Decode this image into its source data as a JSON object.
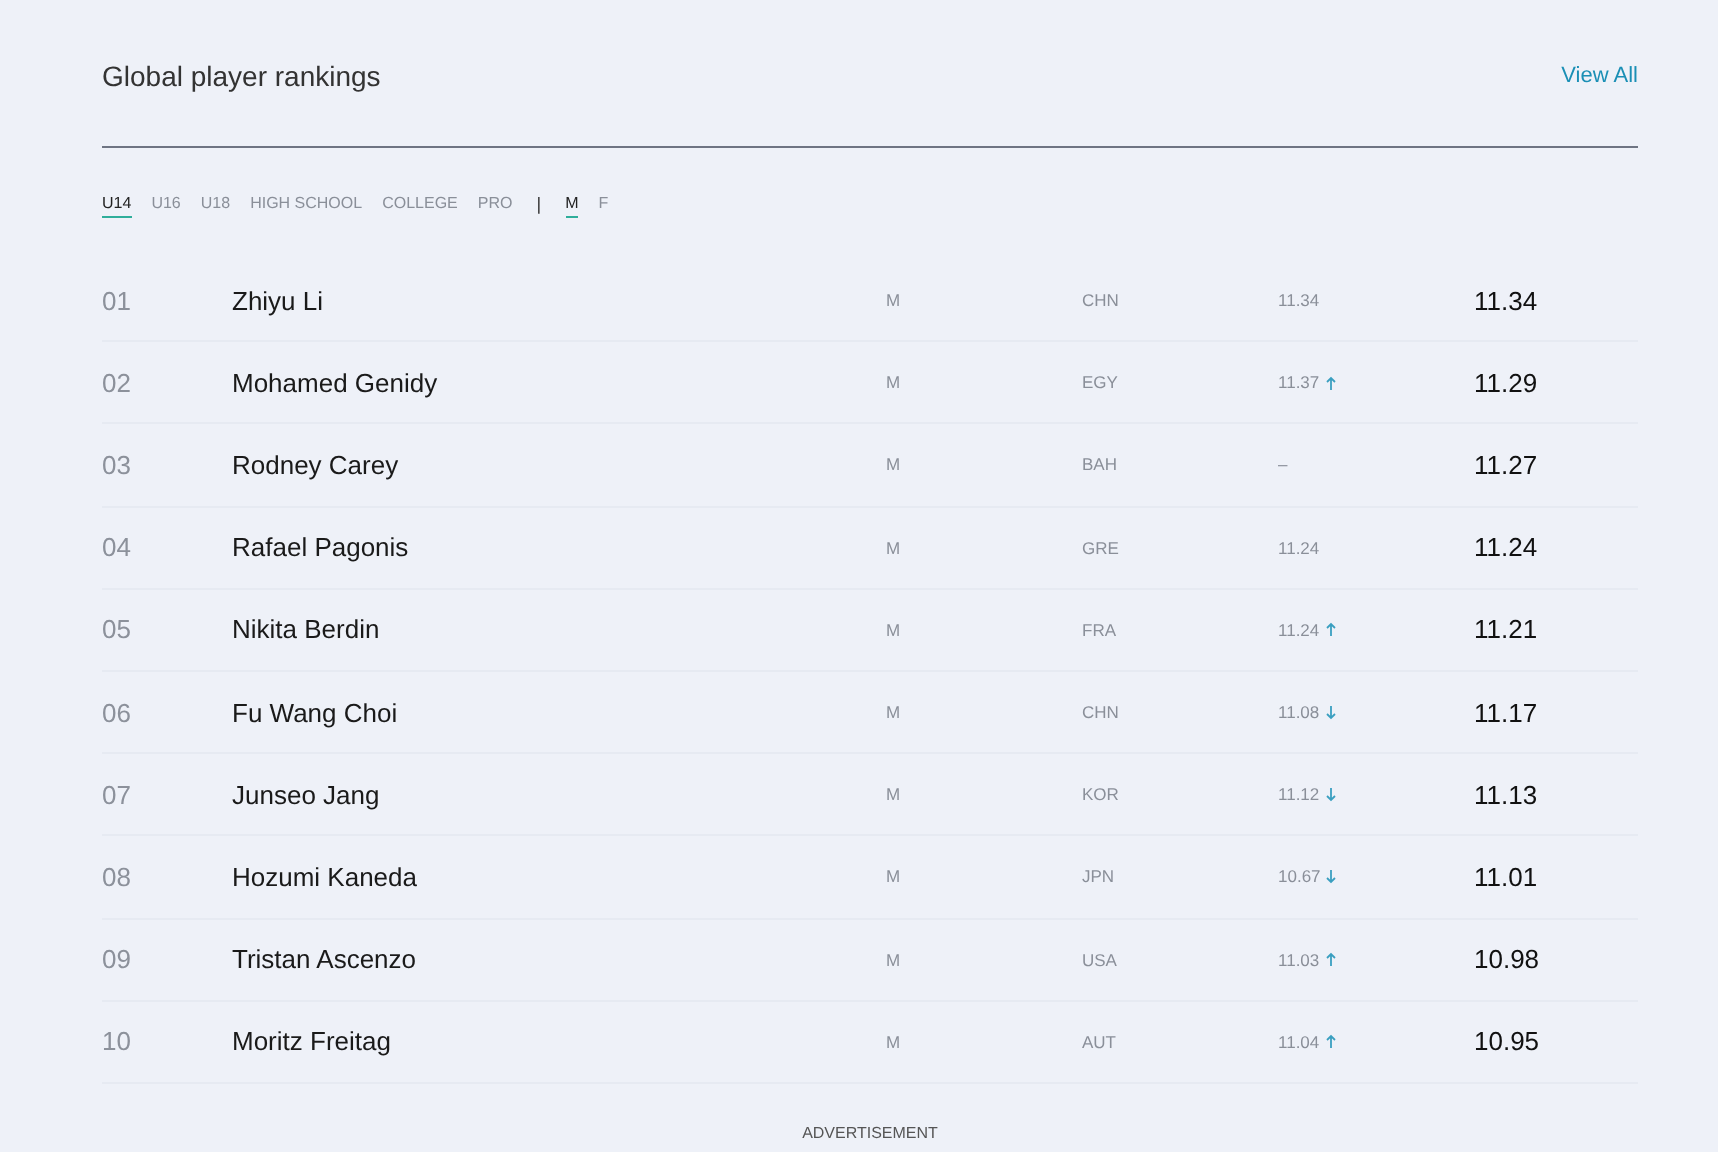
{
  "header": {
    "title": "Global player rankings",
    "link": "View All"
  },
  "filters": {
    "categories": [
      {
        "label": "U14",
        "selected": true
      },
      {
        "label": "U16",
        "selected": false
      },
      {
        "label": "U18",
        "selected": false
      },
      {
        "label": "HIGH SCHOOL",
        "selected": false
      },
      {
        "label": "COLLEGE",
        "selected": false
      },
      {
        "label": "PRO",
        "selected": false
      }
    ],
    "separator": "|",
    "genders": [
      {
        "label": "M",
        "selected": true
      },
      {
        "label": "F",
        "selected": false
      }
    ]
  },
  "rankings": [
    {
      "rank": "01",
      "name": "Zhiyu Li",
      "gender": "M",
      "country": "CHN",
      "previous": "11.34",
      "kind": "steady",
      "score": "11.34"
    },
    {
      "rank": "02",
      "name": "Mohamed Genidy",
      "gender": "M",
      "country": "EGY",
      "previous": "11.37",
      "kind": "rising",
      "score": "11.29"
    },
    {
      "rank": "03",
      "name": "Rodney Carey",
      "gender": "M",
      "country": "BAH",
      "previous": "–",
      "kind": "steady",
      "score": "11.27"
    },
    {
      "rank": "04",
      "name": "Rafael Pagonis",
      "gender": "M",
      "country": "GRE",
      "previous": "11.24",
      "kind": "steady",
      "score": "11.24"
    },
    {
      "rank": "05",
      "name": "Nikita Berdin",
      "gender": "M",
      "country": "FRA",
      "previous": "11.24",
      "kind": "rising",
      "score": "11.21"
    },
    {
      "rank": "06",
      "name": "Fu Wang Choi",
      "gender": "M",
      "country": "CHN",
      "previous": "11.08",
      "kind": "falling",
      "score": "11.17"
    },
    {
      "rank": "07",
      "name": "Junseo Jang",
      "gender": "M",
      "country": "KOR",
      "previous": "11.12",
      "kind": "falling",
      "score": "11.13"
    },
    {
      "rank": "08",
      "name": "Hozumi Kaneda",
      "gender": "M",
      "country": "JPN",
      "previous": "10.67",
      "kind": "falling",
      "score": "11.01"
    },
    {
      "rank": "09",
      "name": "Tristan Ascenzo",
      "gender": "M",
      "country": "USA",
      "previous": "11.03",
      "kind": "rising",
      "score": "10.98"
    },
    {
      "rank": "10",
      "name": "Moritz Freitag",
      "gender": "M",
      "country": "AUT",
      "previous": "11.04",
      "kind": "rising",
      "score": "10.95"
    }
  ],
  "footer": {
    "label": "ADVERTISEMENT"
  }
}
